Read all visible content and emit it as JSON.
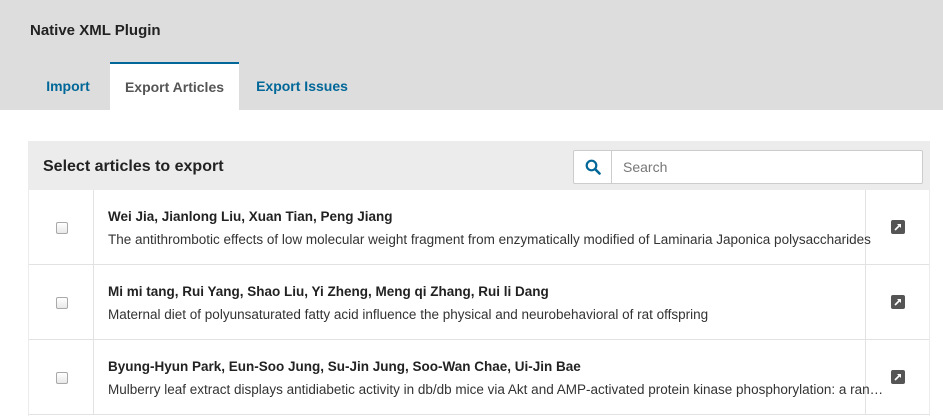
{
  "plugin": {
    "title": "Native XML Plugin"
  },
  "tabs": [
    {
      "label": "Import"
    },
    {
      "label": "Export Articles"
    },
    {
      "label": "Export Issues"
    }
  ],
  "panel": {
    "title": "Select articles to export",
    "search": {
      "placeholder": "Search",
      "value": ""
    }
  },
  "articles": [
    {
      "authors": "Wei Jia, Jianlong Liu, Xuan Tian, Peng Jiang",
      "title": "The antithrombotic effects of low molecular weight fragment from enzymatically modified of Laminaria Japonica polysaccharides"
    },
    {
      "authors": "Mi mi tang, Rui Yang, Shao Liu, Yi Zheng, Meng qi Zhang, Rui li Dang",
      "title": "Maternal diet of polyunsaturated fatty acid influence the physical and neurobehavioral of rat offspring"
    },
    {
      "authors": "Byung-Hyun Park, Eun-Soo Jung, Su-Jin Jung, Soo-Wan Chae, Ui-Jin Bae",
      "title": "Mulberry leaf extract displays antidiabetic activity in db/db mice via Akt and AMP-activated protein kinase phosphorylation: a randomized controlled trial"
    }
  ],
  "colors": {
    "accent": "#006798",
    "header_bg": "#dddddd",
    "panel_header_bg": "#ececec"
  },
  "icons": {
    "search": "search-icon",
    "row_link": "external-link-icon"
  }
}
